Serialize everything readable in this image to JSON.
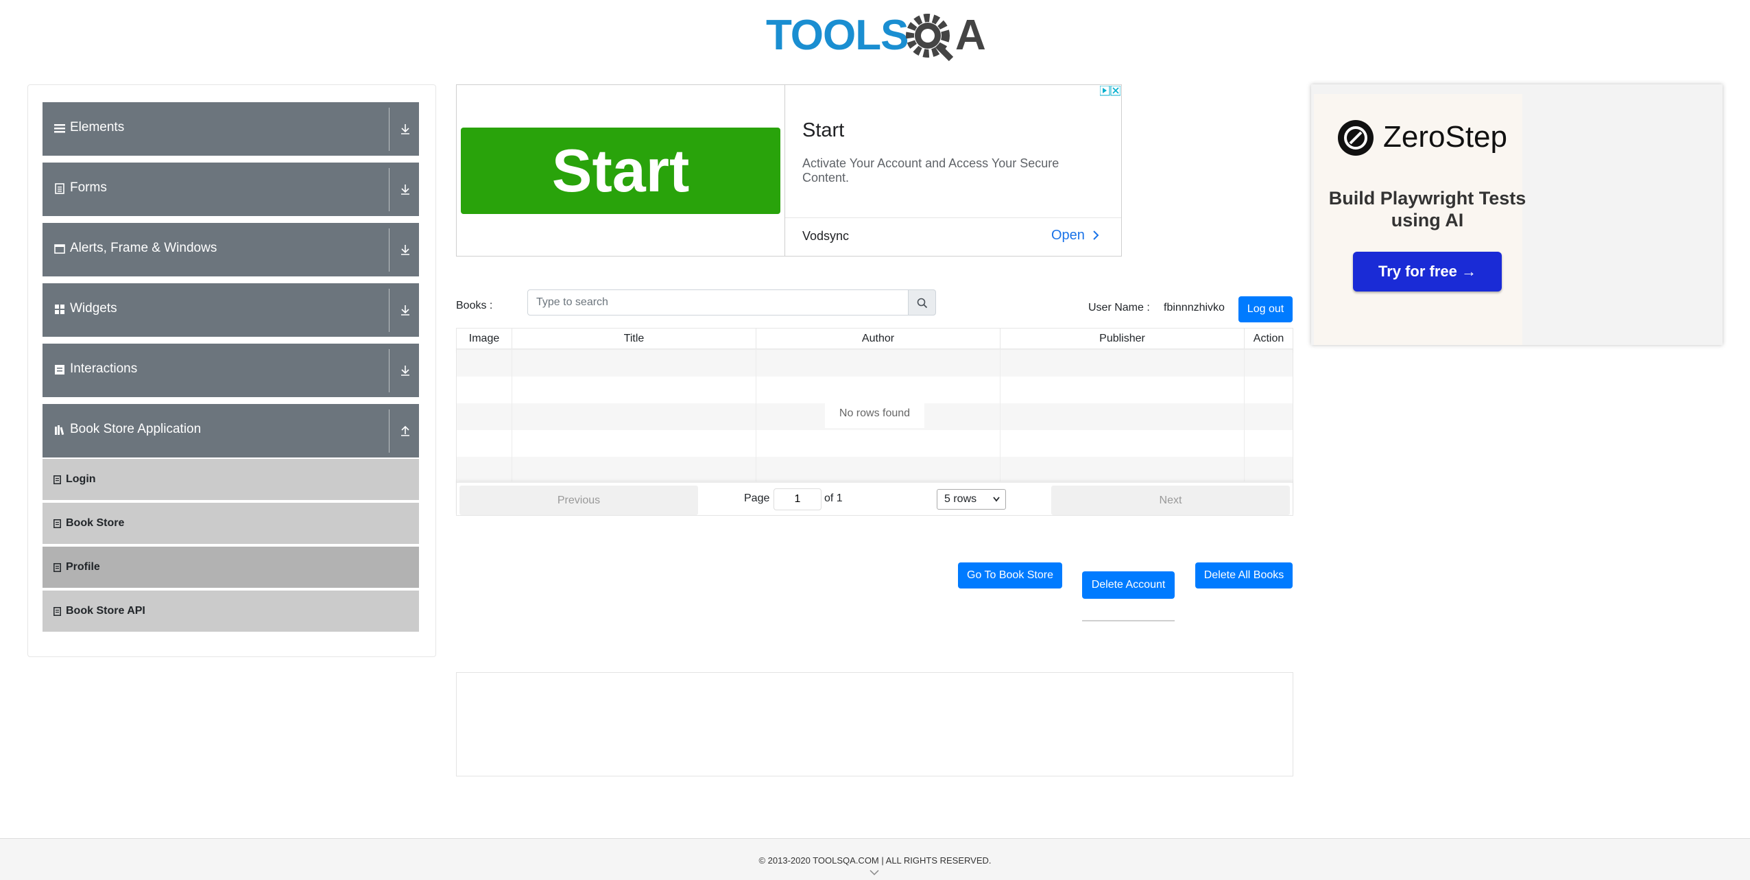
{
  "header": {
    "logo_text_tools": "TOOLS",
    "logo_text_qa": "QA"
  },
  "sidebar": {
    "groups": [
      {
        "label": "Elements",
        "icon": "hamburger-icon",
        "arrow": "download-arrow-icon"
      },
      {
        "label": "Forms",
        "icon": "document-icon",
        "arrow": "download-arrow-icon"
      },
      {
        "label": "Alerts, Frame & Windows",
        "icon": "window-icon",
        "arrow": "download-arrow-icon"
      },
      {
        "label": "Widgets",
        "icon": "grid-icon",
        "arrow": "download-arrow-icon"
      },
      {
        "label": "Interactions",
        "icon": "list-icon",
        "arrow": "download-arrow-icon"
      },
      {
        "label": "Book Store Application",
        "icon": "books-icon",
        "arrow": "upload-arrow-icon"
      }
    ],
    "items": [
      {
        "label": "Login",
        "active": false
      },
      {
        "label": "Book Store",
        "active": false
      },
      {
        "label": "Profile",
        "active": true
      },
      {
        "label": "Book Store API",
        "active": false
      }
    ]
  },
  "ad": {
    "image_text": "Start",
    "title": "Start",
    "description": "Activate Your Account and Access Your Secure Content.",
    "brand": "Vodsync",
    "open_label": "Open"
  },
  "right_ad": {
    "brand": "ZeroStep",
    "headline": "Build Playwright Tests using AI",
    "button": "Try for free →"
  },
  "profile": {
    "books_label": "Books :",
    "search_placeholder": "Type to search",
    "user_label": "User Name :",
    "user_value": "fbinnnzhivko",
    "logout": "Log out"
  },
  "table": {
    "columns": [
      "Image",
      "Title",
      "Author",
      "Publisher",
      "Action"
    ],
    "empty_text": "No rows found",
    "previous": "Previous",
    "next": "Next",
    "page_label": "Page",
    "page_value": "1",
    "of_label": "of 1",
    "rows_option": "5 rows"
  },
  "actions": {
    "go_to_store": "Go To Book Store",
    "delete_account": "Delete Account",
    "delete_all": "Delete All Books"
  },
  "footer": {
    "copyright": "© 2013-2020 TOOLSQA.COM | ALL RIGHTS RESERVED."
  },
  "colors": {
    "primary": "#007bff",
    "sidebar": "#6c757d",
    "ad_green": "#29a30b",
    "zerostep_blue": "#1a2bd6"
  }
}
